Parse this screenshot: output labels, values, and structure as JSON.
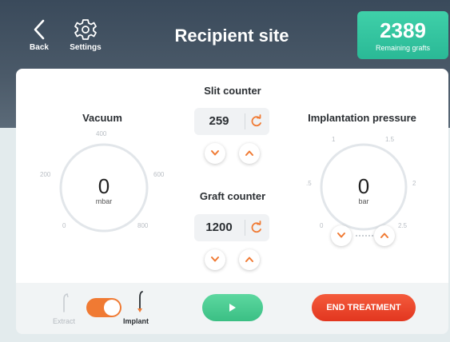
{
  "header": {
    "back_label": "Back",
    "settings_label": "Settings",
    "title": "Recipient site",
    "grafts_value": "2389",
    "grafts_label": "Remaining grafts"
  },
  "vacuum": {
    "title": "Vacuum",
    "value": "0",
    "unit": "mbar",
    "scale": [
      "0",
      "200",
      "400",
      "600",
      "800"
    ]
  },
  "slit_counter": {
    "title": "Slit counter",
    "value": "259"
  },
  "graft_counter": {
    "title": "Graft counter",
    "value": "1200"
  },
  "pressure": {
    "title": "Implantation pressure",
    "value": "0",
    "unit": "bar",
    "scale": [
      "0",
      ".5",
      "1",
      "1.5",
      "2",
      "2.5"
    ]
  },
  "footer": {
    "extract_label": "Extract",
    "implant_label": "Implant",
    "mode_toggle_on": true,
    "end_label": "END TREATMENT"
  },
  "colors": {
    "accent_orange": "#f07a33",
    "play_green": "#3bbf84",
    "end_red": "#e2361f",
    "grafts_teal": "#2ab996"
  },
  "icons": {
    "back": "chevron-left-icon",
    "settings": "gear-icon",
    "reset": "reset-icon",
    "increase": "chevron-up-icon",
    "decrease": "chevron-down-icon",
    "play": "play-icon",
    "extract_tool": "extract-tool-icon",
    "implant_tool": "implant-tool-icon"
  }
}
